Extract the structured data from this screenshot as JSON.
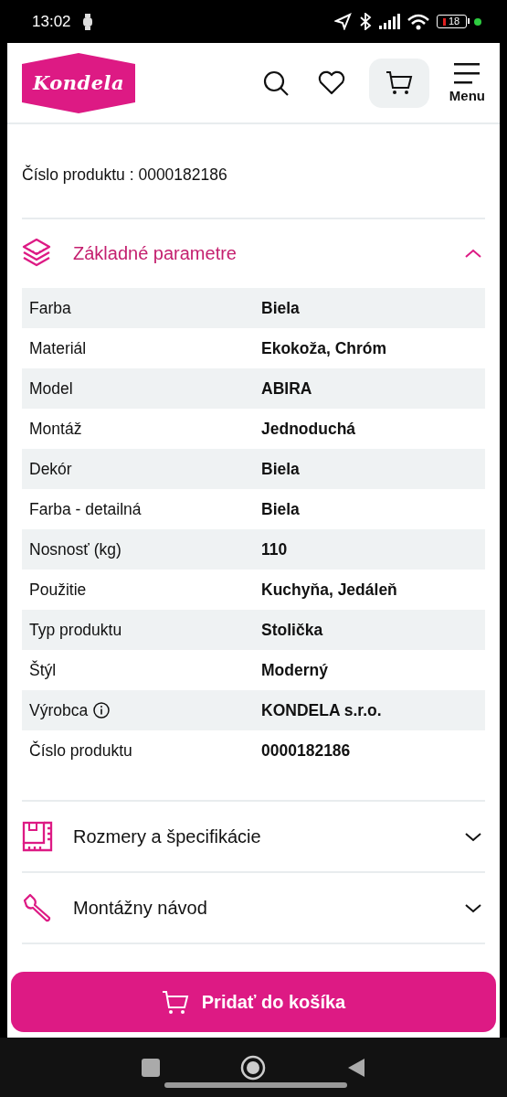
{
  "status_bar": {
    "time": "13:02",
    "battery": "18"
  },
  "header": {
    "logo": "Kondela",
    "menu_label": "Menu"
  },
  "product_number": "Číslo produktu : 0000182186",
  "sections": [
    {
      "title": "Základné parametre",
      "expanded": true,
      "rows": [
        {
          "label": "Farba",
          "value": "Biela",
          "info": false
        },
        {
          "label": "Materiál",
          "value": "Ekokoža, Chróm",
          "info": false
        },
        {
          "label": "Model",
          "value": "ABIRA",
          "info": false
        },
        {
          "label": "Montáž",
          "value": "Jednoduchá",
          "info": false
        },
        {
          "label": "Dekór",
          "value": "Biela",
          "info": false
        },
        {
          "label": "Farba - detailná",
          "value": "Biela",
          "info": false
        },
        {
          "label": "Nosnosť (kg)",
          "value": "110",
          "info": false
        },
        {
          "label": "Použitie",
          "value": "Kuchyňa, Jedáleň",
          "info": false
        },
        {
          "label": "Typ produktu",
          "value": "Stolička",
          "info": false
        },
        {
          "label": "Štýl",
          "value": "Moderný",
          "info": false
        },
        {
          "label": "Výrobca",
          "value": "KONDELA s.r.o.",
          "info": true
        },
        {
          "label": "Číslo produktu",
          "value": "0000182186",
          "info": false
        }
      ]
    },
    {
      "title": "Rozmery a špecifikácie",
      "expanded": false
    },
    {
      "title": "Montážny návod",
      "expanded": false
    }
  ],
  "cart_button": {
    "label": "Pridať do košíka"
  }
}
